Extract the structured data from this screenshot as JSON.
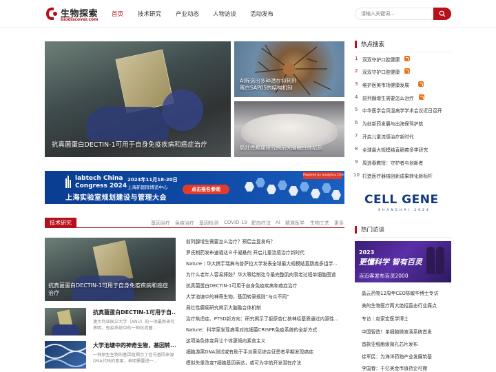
{
  "header": {
    "logo_cn": "生物探索",
    "logo_en": "biodiscover.com",
    "nav": [
      "首页",
      "技术研究",
      "产业动态",
      "人物访谈",
      "活动发布"
    ],
    "search_placeholder": "请输入关键词..."
  },
  "hero": {
    "main_caption": "抗真菌蛋白DECTIN-1可用于自身免疫疾病和癌症治疗",
    "r1_caption_line1": "AI筛选出多种潜在抑制剂",
    "r1_caption_line2": "蛋白SAP05的结构机制",
    "r2_caption": "局灶性癫痫研究揭示大脑融合体机制"
  },
  "banner": {
    "logo_line1": "labtech China",
    "logo_line2": "Congress 2024",
    "date": "2024年11月18-20日",
    "venue": "上海新国际博览中心",
    "cta": "点击报名参观",
    "main": "上海实验室规划建设与管理大会",
    "powered": "Powered by analytica China"
  },
  "tech": {
    "tag": "技术研究",
    "tabs": [
      "基因治疗",
      "免疫治疗",
      "基因检测",
      "COVID-19",
      "靶向疗法",
      "AI",
      "精准医学",
      "生物工艺",
      "更多"
    ],
    "main_caption": "抗真菌蛋白DECTIN-1可用于自身免疫疾病和癌症治疗",
    "items": [
      {
        "title": "抗真菌蛋白DECTIN-1可用于自...",
        "desc": "澳大利亚国立大学（ANU）的一项最新研究表明，免疫系统中的一种抗真菌..."
      },
      {
        "title": "大学池塘中的神奇生物，基因转...",
        "desc": "一种原生生物的基因组揭示了信号基因来源DNA代码的意果，表明需要进一..."
      }
    ],
    "news": [
      "前列腺增生需要怎么治疗？预后会复发吗？",
      "罗氏制药发布速福达®千凝悬剂 开启儿童流感治疗新时代",
      "Nature｜华大携手瑞典乌普萨拉大学发表全球最大规模结直肠癌多组学...",
      "为什么老年人容易摔跤？华大等绘制迄今最完整肌肉衰老过程单细胞图谱",
      "抗真菌蛋白DECTIN-1可用于自身免疫疾病和癌症治疗",
      "大学池塘中的神奇生物，基因转录规则“与众不同”",
      "局灶性癫痫研究揭示大脑融合体机制",
      "治疗焦虑症、PTSD新方向：研究揭示了扳原杏仁核神经基质通过内源性...",
      "Nature：科学家发现病毒对抗细菌CRISPR免疫系统的全新方式",
      "这项染色体变异让个体更倾向素食主义",
      "细胞游离DNA测试或有助于手淡黄尼综合征患者早期发现癌症",
      "模拟失重改变T细胞基因表达，或可为宇航开发潜在疗法"
    ]
  },
  "sidebar": {
    "hot_title": "热点搜索",
    "hot": [
      {
        "num": "1",
        "text": "双双守护口腔健康",
        "badge": true
      },
      {
        "num": "2",
        "text": "双双守护口腔健康",
        "badge": true
      },
      {
        "num": "3",
        "text": "维护医美市场健康发展",
        "badge": true
      },
      {
        "num": "4",
        "text": "前列腺增生需要怎么治疗",
        "badge": true
      },
      {
        "num": "5",
        "text": "中华医学会风湿病学学术会议近日召开",
        "badge": false
      },
      {
        "num": "6",
        "text": "为创新药发展与出海保驾护航",
        "badge": false
      },
      {
        "num": "7",
        "text": "开启儿童流感治疗新时代",
        "badge": false
      },
      {
        "num": "8",
        "text": "全球最大规模结直肠癌多学研究",
        "badge": false
      },
      {
        "num": "9",
        "text": "周选春教授：守护者与创新者",
        "badge": false
      },
      {
        "num": "10",
        "text": "打造医疗器械创新成果转化新标杆",
        "badge": false
      }
    ],
    "cellgene_main": "CELL GENE",
    "cellgene_sub": "SHANGHAI 2024",
    "visit_title": "热门访谈",
    "visit_img_year": "2023",
    "visit_img_big": "更懂科学 智有百灵",
    "visit_img_cap": "百迈客发布百灵2000",
    "visits": [
      "晶云药物12周年CEO陈敏华博士专访",
      "美的生物医疗两大绝招直击行业痛点",
      "专访｜赵家宏医学博士",
      "中国智造！单细胞微液滴系统首发",
      "首款亚细胞级微孔芯片发布",
      "徐军民：为海洋药物产业发展筑基",
      "李国春：千亿美金市值药企可期"
    ]
  },
  "colors": {
    "brand": "#b5101c",
    "badge": "#e8731f"
  }
}
